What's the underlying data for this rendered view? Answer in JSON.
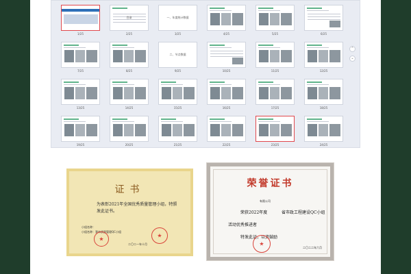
{
  "viewer": {
    "rows": [
      [
        {
          "num": "1/25",
          "kind": "cover",
          "selected": true,
          "text": ""
        },
        {
          "num": "2/25",
          "kind": "toc",
          "selected": false,
          "text": "目录"
        },
        {
          "num": "3/25",
          "kind": "section",
          "selected": false,
          "text": "一、年度统计数据"
        },
        {
          "num": "4/25",
          "kind": "photos",
          "selected": false,
          "text": ""
        },
        {
          "num": "5/25",
          "kind": "photos",
          "selected": false,
          "text": ""
        },
        {
          "num": "6/25",
          "kind": "text",
          "selected": false,
          "text": ""
        }
      ],
      [
        {
          "num": "7/25",
          "kind": "photos",
          "selected": false,
          "text": ""
        },
        {
          "num": "8/25",
          "kind": "photos",
          "selected": false,
          "text": ""
        },
        {
          "num": "9/25",
          "kind": "section",
          "selected": false,
          "text": "二、节点数据"
        },
        {
          "num": "10/25",
          "kind": "text",
          "selected": false,
          "text": ""
        },
        {
          "num": "11/25",
          "kind": "photos",
          "selected": false,
          "text": ""
        },
        {
          "num": "12/25",
          "kind": "photos",
          "selected": false,
          "text": ""
        }
      ],
      [
        {
          "num": "13/25",
          "kind": "photos",
          "selected": false,
          "text": ""
        },
        {
          "num": "14/25",
          "kind": "photos",
          "selected": false,
          "text": ""
        },
        {
          "num": "15/25",
          "kind": "photos",
          "selected": false,
          "text": ""
        },
        {
          "num": "16/25",
          "kind": "photos",
          "selected": false,
          "text": ""
        },
        {
          "num": "17/25",
          "kind": "photos",
          "selected": false,
          "text": ""
        },
        {
          "num": "18/25",
          "kind": "photos",
          "selected": false,
          "text": ""
        }
      ],
      [
        {
          "num": "19/25",
          "kind": "photos",
          "selected": false,
          "text": ""
        },
        {
          "num": "20/25",
          "kind": "photos",
          "selected": false,
          "text": ""
        },
        {
          "num": "21/25",
          "kind": "photos",
          "selected": false,
          "text": ""
        },
        {
          "num": "22/25",
          "kind": "photos",
          "selected": false,
          "text": ""
        },
        {
          "num": "23/25",
          "kind": "photos",
          "selected": true,
          "text": ""
        },
        {
          "num": "24/25",
          "kind": "photos",
          "selected": false,
          "text": ""
        }
      ]
    ],
    "scroll_up_icon": "⌃",
    "scroll_down_icon": "⌄"
  },
  "certificate1": {
    "title": "证书",
    "body": "为表彰2021年全国优秀质量管理小组，特颁发此证书。",
    "small_lines": [
      "小组名称：",
      "小组名称：我市质量管理QC小组"
    ],
    "date": "二〇二一年十月"
  },
  "certificate2": {
    "title": "荣誉证书",
    "recipient": "有限公司",
    "line1_a": "荣获2022年度",
    "line1_b": "省市政工程建设QC小组",
    "line2": "活动优秀推进者",
    "line3": "特发此证，以资鼓励",
    "date": "二〇二二年六月"
  },
  "colors": {
    "side_bar": "#1f3d2b",
    "viewer_bg": "#e9ecf3",
    "selection": "#e0474c",
    "cert1_bg": "#f2e6b5",
    "cert2_title": "#c23a2b",
    "seal": "#d9433a"
  }
}
